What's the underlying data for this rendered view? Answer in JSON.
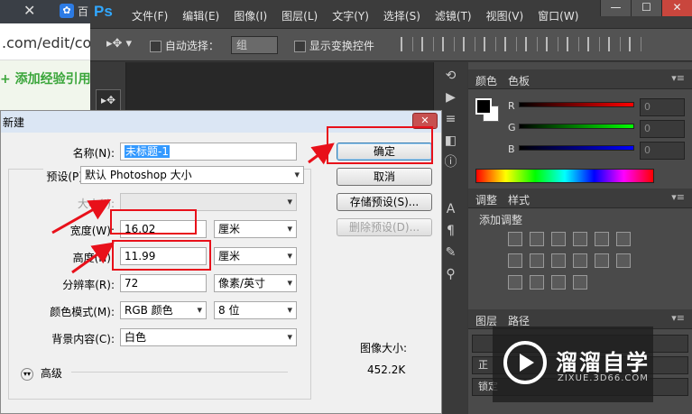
{
  "browser": {
    "tab_close": "✕",
    "tab_favicon": "✿",
    "tab_title": "百",
    "url": ".com/edit/co",
    "page_link": "+ 添加经验引用"
  },
  "photoshop": {
    "logo": "Ps",
    "menu": [
      "文件(F)",
      "编辑(E)",
      "图像(I)",
      "图层(L)",
      "文字(Y)",
      "选择(S)",
      "滤镜(T)",
      "视图(V)",
      "窗口(W)"
    ],
    "window_buttons": [
      "—",
      "☐",
      "✕"
    ],
    "options_bar": {
      "auto_select_label": "自动选择：",
      "auto_select_value": "组",
      "show_transform_label": "显示变换控件"
    },
    "panels": {
      "color_tab": "颜色",
      "swatches_tab": "色板",
      "sliders": [
        {
          "label": "R",
          "value": "0"
        },
        {
          "label": "G",
          "value": "0"
        },
        {
          "label": "B",
          "value": "0"
        }
      ],
      "adjustments_tab": "调整",
      "styles_tab": "样式",
      "add_adjustment": "添加调整",
      "layers_tab": "图层",
      "paths_tab": "路径",
      "layer_rows": [
        "",
        "正",
        "锁定"
      ]
    }
  },
  "watermark": {
    "brand": "溜溜自学",
    "url": "ZIXUE.3D66.COM"
  },
  "dialog": {
    "title": "新建",
    "close": "✕",
    "name_label": "名称(N):",
    "name_value": "未标题-1",
    "preset_label": "预设(P):",
    "preset_value": "默认 Photoshop 大小",
    "size_label": "大小(I):",
    "width_label": "宽度(W):",
    "width_value": "16.02",
    "width_unit": "厘米",
    "height_label": "高度(H):",
    "height_value": "11.99",
    "height_unit": "厘米",
    "resolution_label": "分辨率(R):",
    "resolution_value": "72",
    "resolution_unit": "像素/英寸",
    "color_mode_label": "颜色模式(M):",
    "color_mode_value": "RGB 颜色",
    "bit_depth_value": "8 位",
    "background_label": "背景内容(C):",
    "background_value": "白色",
    "advanced_label": "高级",
    "ok_button": "确定",
    "cancel_button": "取消",
    "save_preset_button": "存储预设(S)...",
    "delete_preset_button": "删除预设(D)...",
    "image_size_label": "图像大小:",
    "image_size_value": "452.2K"
  },
  "colors": {
    "annotation": "#e8101a",
    "ps_accent": "#31a8ff",
    "selection": "#3399ff"
  }
}
